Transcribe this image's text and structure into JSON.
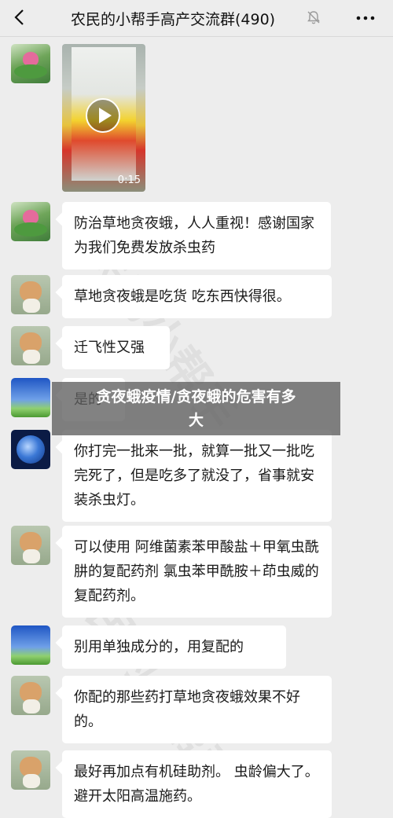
{
  "header": {
    "title": "农民的小帮手高产交流群(490)"
  },
  "video": {
    "duration": "0:15"
  },
  "messages": [
    {
      "avatar": "lotus-avatar",
      "text": "防治草地贪夜蛾，人人重视！感谢国家为我们免费发放杀虫药"
    },
    {
      "avatar": "dog-avatar",
      "text": "草地贪夜蛾是吃货  吃东西快得很。"
    },
    {
      "avatar": "dog-avatar",
      "text": "迁飞性又强"
    },
    {
      "avatar": "sky-avatar",
      "text": "是的"
    },
    {
      "avatar": "globe-avatar",
      "text": "你打完一批来一批，就算一批又一批吃完死了，但是吃多了就没了，省事就安装杀虫灯。"
    },
    {
      "avatar": "dog-avatar",
      "text": "可以使用  阿维菌素苯甲酸盐＋甲氧虫酰肼的复配药剂     氯虫苯甲酰胺＋茚虫威的复配药剂。"
    },
    {
      "avatar": "sky-avatar",
      "text": "别用单独成分的，用复配的"
    },
    {
      "avatar": "dog-avatar",
      "text": "你配的那些药打草地贪夜蛾效果不好的。"
    },
    {
      "avatar": "dog-avatar",
      "text": "最好再加点有机硅助剂。 虫龄偏大了。 避开太阳高温施药。"
    }
  ],
  "watermark": {
    "text": "农民的小帮手"
  },
  "overlay": {
    "line1": "贪夜蛾疫情/贪夜蛾的危害有多",
    "line2": "大"
  }
}
